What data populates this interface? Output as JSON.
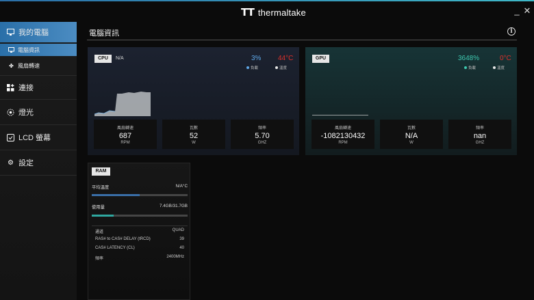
{
  "window": {
    "brand": "thermaltake",
    "brand_mark": "TT",
    "minimize": "_",
    "close": "✕"
  },
  "sidebar": {
    "items": [
      {
        "label": "我的電腦",
        "icon": "monitor-icon",
        "active": true
      },
      {
        "label": "電腦資訊",
        "icon": "monitor-small-icon",
        "active": true,
        "sub": true
      },
      {
        "label": "風扇轉速",
        "icon": "fan-icon",
        "sub": true
      },
      {
        "label": "連接",
        "icon": "grid-plus-icon"
      },
      {
        "label": "燈光",
        "icon": "light-icon"
      },
      {
        "label": "LCD 螢幕",
        "icon": "lcd-icon"
      },
      {
        "label": "設定",
        "icon": "gear-icon"
      }
    ]
  },
  "page": {
    "title": "電腦資訊",
    "info": "i"
  },
  "cpu": {
    "tag": "CPU",
    "name": "N/A",
    "load": "3%",
    "temp": "44°C",
    "load_legend": "負載",
    "temp_legend": "溫度",
    "load_color": "#5fa8e8",
    "temp_color": "#e0302a",
    "stats": [
      {
        "label": "風扇轉速",
        "value": "687",
        "unit": "RPM"
      },
      {
        "label": "瓦數",
        "value": "52",
        "unit": "W"
      },
      {
        "label": "頻率",
        "value": "5.70",
        "unit": "GHZ"
      }
    ]
  },
  "gpu": {
    "tag": "GPU",
    "load": "3648%",
    "temp": "0°C",
    "load_legend": "負載",
    "temp_legend": "溫度",
    "load_color": "#3ec9b0",
    "stats": [
      {
        "label": "風扇轉速",
        "value": "-1082130432",
        "unit": "RPM"
      },
      {
        "label": "瓦數",
        "value": "N/A",
        "unit": "W"
      },
      {
        "label": "頻率",
        "value": "nan",
        "unit": "GHZ"
      }
    ]
  },
  "ram": {
    "tag": "RAM",
    "avg_temp_label": "平均溫度",
    "avg_temp_value": "N/A°C",
    "usage_label": "使用量",
    "usage_value": "7.4GB/31.7GB",
    "usage_fraction": 0.23,
    "temp_fraction": 0.5,
    "temp_bar_color": "#3a6fa8",
    "usage_bar_color": "#2fa8a0",
    "details": [
      {
        "label": "通道",
        "value": "QUAD"
      },
      {
        "label": "RAS# to CAS# DELAY (tRCD)",
        "value": "39"
      },
      {
        "label": "CAS# LATENCY (CL)",
        "value": "40"
      },
      {
        "label": "頻率",
        "value": "2400MHz"
      }
    ]
  }
}
